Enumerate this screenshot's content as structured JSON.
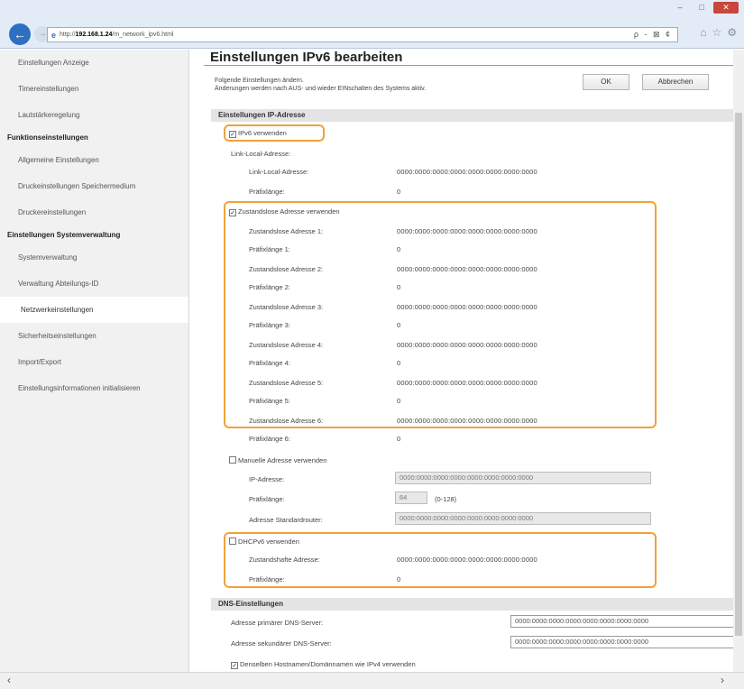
{
  "browser": {
    "url_prefix": "http://",
    "url_host": "192.168.1.24",
    "url_path": "/m_network_ipv6.html",
    "address_tools": "ρ - ⊠ ¢",
    "window_controls": [
      "–",
      "□",
      "✕"
    ]
  },
  "sidebar": {
    "items": [
      {
        "type": "item",
        "label": "Einstellungen Anzeige"
      },
      {
        "type": "item",
        "label": "Timereinstellungen"
      },
      {
        "type": "item",
        "label": "Lautstärkeregelung"
      },
      {
        "type": "head",
        "label": "Funktionseinstellungen"
      },
      {
        "type": "item",
        "label": "Allgemeine Einstellungen"
      },
      {
        "type": "item",
        "label": "Druckeinstellungen Speichermedium"
      },
      {
        "type": "item",
        "label": "Druckereinstellungen"
      },
      {
        "type": "head",
        "label": "Einstellungen Systemverwaltung"
      },
      {
        "type": "item",
        "label": "Systemverwaltung"
      },
      {
        "type": "item",
        "label": "Verwaltung Abteilungs-ID"
      },
      {
        "type": "item",
        "label": "Netzwerkeinstellungen",
        "active": true
      },
      {
        "type": "item",
        "label": "Sicherheitseinstellungen"
      },
      {
        "type": "item",
        "label": "Import/Export"
      },
      {
        "type": "item",
        "label": "Einstellungsinformationen initialisieren"
      }
    ]
  },
  "main": {
    "title": "Einstellungen IPv6 bearbeiten",
    "info_line1": "Folgende Einstellungen ändern.",
    "info_line2": "Änderungen werden nach AUS- und wieder EINschalten des Systems aktiv.",
    "ok_label": "OK",
    "cancel_label": "Abbrechen",
    "ip_section": "Einstellungen IP-Adresse",
    "use_ipv6": "IPv6 verwenden",
    "link_local_heading": "Link-Local-Adresse:",
    "link_local_label": "Link-Local-Adresse:",
    "link_local_value": "0000:0000:0000:0000:0000:0000:0000:0000",
    "prefix_label": "Präfixlänge:",
    "prefix_value": "0",
    "stateless_use": "Zustandslose Adresse verwenden",
    "stateless": [
      {
        "addr_label": "Zustandslose Adresse 1:",
        "addr": "0000:0000:0000:0000:0000:0000:0000:0000",
        "prefix_label": "Präfixlänge 1:",
        "prefix": "0"
      },
      {
        "addr_label": "Zustandslose Adresse 2:",
        "addr": "0000:0000:0000:0000:0000:0000:0000:0000",
        "prefix_label": "Präfixlänge 2:",
        "prefix": "0"
      },
      {
        "addr_label": "Zustandslose Adresse 3:",
        "addr": "0000:0000:0000:0000:0000:0000:0000:0000",
        "prefix_label": "Präfixlänge 3:",
        "prefix": "0"
      },
      {
        "addr_label": "Zustandslose Adresse 4:",
        "addr": "0000:0000:0000:0000:0000:0000:0000:0000",
        "prefix_label": "Präfixlänge 4:",
        "prefix": "0"
      },
      {
        "addr_label": "Zustandslose Adresse 5:",
        "addr": "0000:0000:0000:0000:0000:0000:0000:0000",
        "prefix_label": "Präfixlänge 5:",
        "prefix": "0"
      },
      {
        "addr_label": "Zustandslose Adresse 6:",
        "addr": "0000:0000:0000:0000:0000:0000:0000:0000",
        "prefix_label": "Präfixlänge 6:",
        "prefix": "0"
      }
    ],
    "manual_use": "Manuelle Adresse verwenden",
    "manual_ip_label": "IP-Adresse:",
    "manual_ip_value": "0000:0000:0000:0000:0000:0000:0000:0000",
    "manual_prefix_label": "Präfixlänge:",
    "manual_prefix_value": "64",
    "manual_prefix_range": "(0-128)",
    "manual_router_label": "Adresse Standardrouter:",
    "manual_router_value": "0000:0000:0000:0000:0000:0000:0000:0000",
    "dhcp_use": "DHCPv6 verwenden",
    "dhcp_addr_label": "Zustandshafte Adresse:",
    "dhcp_addr_value": "0000:0000:0000:0000:0000:0000:0000:0000",
    "dhcp_prefix_label": "Präfixlänge:",
    "dhcp_prefix_value": "0",
    "dns_section": "DNS-Einstellungen",
    "dns_primary_label": "Adresse primärer DNS-Server:",
    "dns_primary_value": "0000:0000:0000:0000:0000:0000:0000:0000",
    "dns_secondary_label": "Adresse sekundärer DNS-Server:",
    "dns_secondary_value": "0000:0000:0000:0000:0000:0000:0000:0000",
    "same_hostname": "Denselben Hostnamen/Domännamen wie IPv4 verwenden"
  },
  "colors": {
    "highlight": "#f0a23a",
    "accent": "#2f6fc2"
  }
}
